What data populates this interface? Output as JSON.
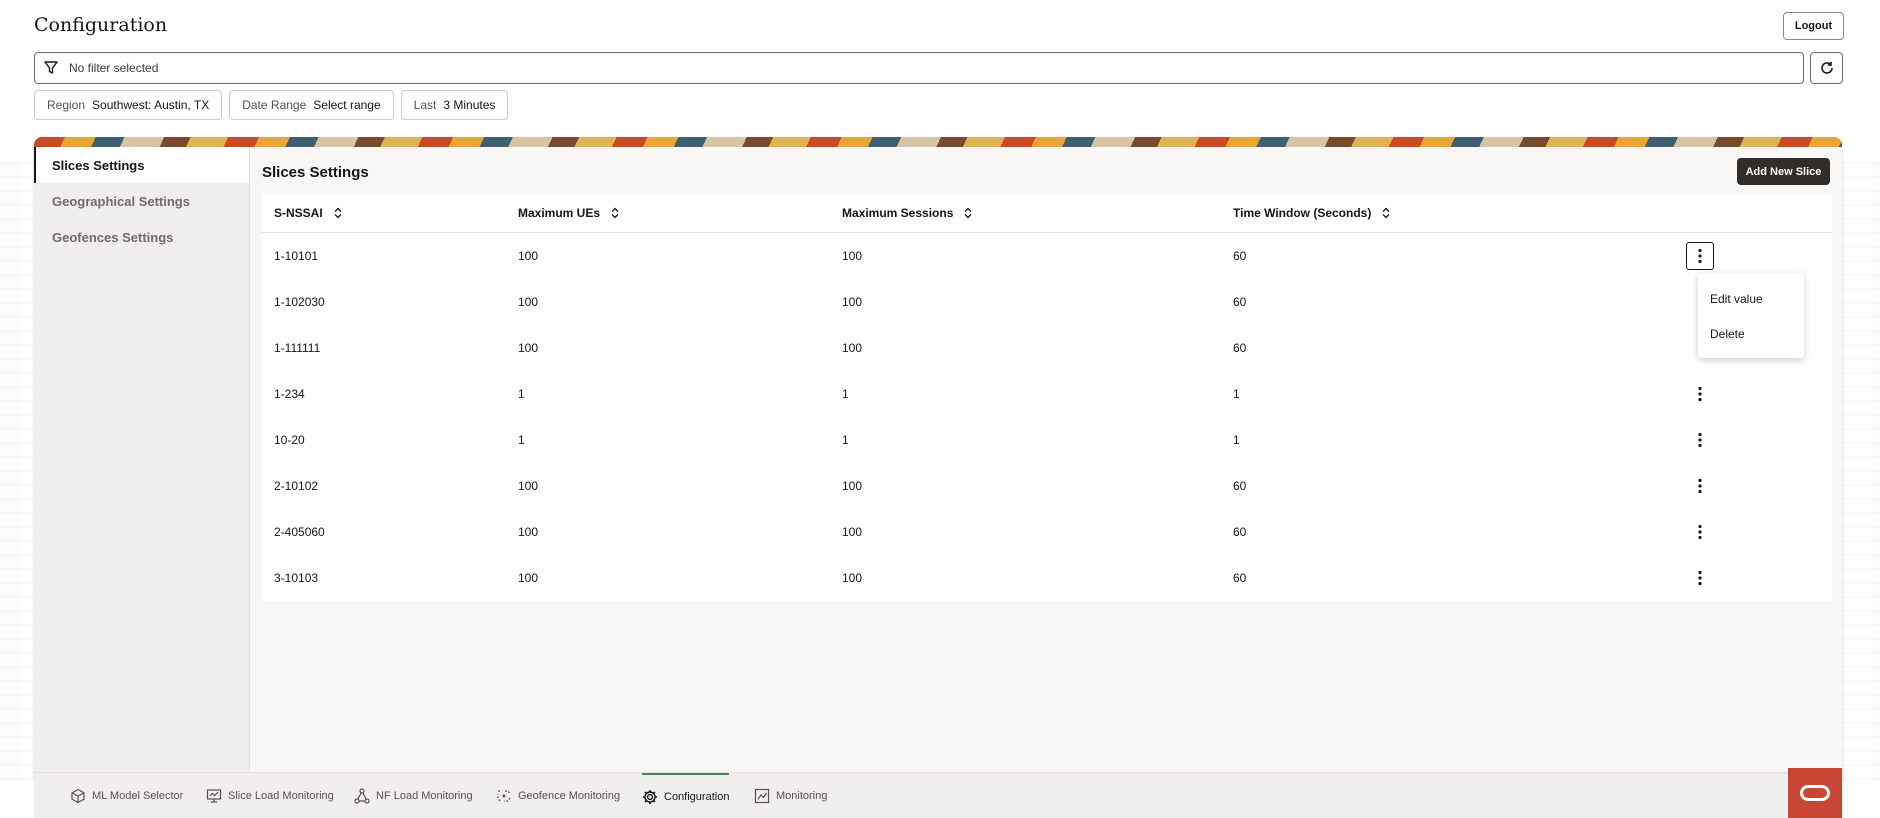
{
  "page": {
    "title": "Configuration",
    "logout_label": "Logout"
  },
  "filter": {
    "text": "No filter selected"
  },
  "chips": [
    {
      "key": "Region",
      "value": "Southwest: Austin, TX"
    },
    {
      "key": "Date Range",
      "value": "Select range"
    },
    {
      "key": "Last",
      "value": "3 Minutes"
    }
  ],
  "sidebar": {
    "items": [
      {
        "label": "Slices Settings",
        "active": true
      },
      {
        "label": "Geographical Settings",
        "active": false
      },
      {
        "label": "Geofences Settings",
        "active": false
      }
    ]
  },
  "content": {
    "title": "Slices Settings",
    "add_label": "Add New Slice",
    "columns": [
      "S-NSSAI",
      "Maximum UEs",
      "Maximum Sessions",
      "Time Window (Seconds)"
    ],
    "rows": [
      [
        "1-10101",
        "100",
        "100",
        "60"
      ],
      [
        "1-102030",
        "100",
        "100",
        "60"
      ],
      [
        "1-111111",
        "100",
        "100",
        "60"
      ],
      [
        "1-234",
        "1",
        "1",
        "1"
      ],
      [
        "10-20",
        "1",
        "1",
        "1"
      ],
      [
        "2-10102",
        "100",
        "100",
        "60"
      ],
      [
        "2-405060",
        "100",
        "100",
        "60"
      ],
      [
        "3-10103",
        "100",
        "100",
        "60"
      ]
    ]
  },
  "row_menu": {
    "items": [
      "Edit value",
      "Delete"
    ]
  },
  "bottom_nav": {
    "items": [
      {
        "label": "ML Model Selector",
        "icon": "cube-icon"
      },
      {
        "label": "Slice Load Monitoring",
        "icon": "monitor-icon"
      },
      {
        "label": "NF Load Monitoring",
        "icon": "network-nodes-icon"
      },
      {
        "label": "Geofence Monitoring",
        "icon": "geofence-icon"
      },
      {
        "label": "Configuration",
        "icon": "gear-icon",
        "active": true
      },
      {
        "label": "Monitoring",
        "icon": "chart-icon"
      }
    ]
  },
  "colors": {
    "accent_dark": "#312d2a",
    "brand_red": "#c74634",
    "active_nav": "#4c825c"
  }
}
